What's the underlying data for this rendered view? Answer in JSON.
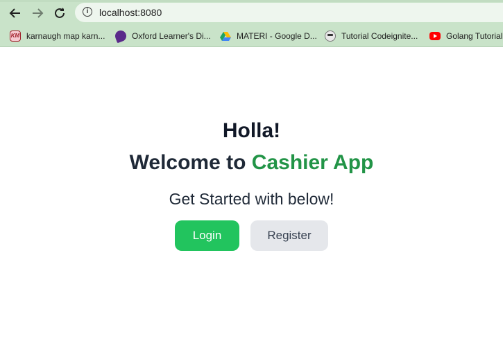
{
  "browser": {
    "url": "localhost:8080",
    "bookmarks": [
      {
        "label": "karnaugh map karn...",
        "icon": "karnaugh-icon"
      },
      {
        "label": "Oxford Learner's Di...",
        "icon": "oxford-icon"
      },
      {
        "label": "MATERI - Google D...",
        "icon": "google-drive-icon"
      },
      {
        "label": "Tutorial Codeignite...",
        "icon": "codeigniter-icon"
      },
      {
        "label": "Golang Tutorial",
        "icon": "youtube-icon"
      }
    ]
  },
  "page": {
    "greeting": "Holla!",
    "welcome_prefix": "Welcome to ",
    "app_name": "Cashier App",
    "subtitle": "Get Started with below!",
    "login_label": "Login",
    "register_label": "Register"
  },
  "colors": {
    "accent": "#229447",
    "login_bg": "#22c45e",
    "register_bg": "#e5e7eb",
    "chrome": "#c9e3c9"
  }
}
